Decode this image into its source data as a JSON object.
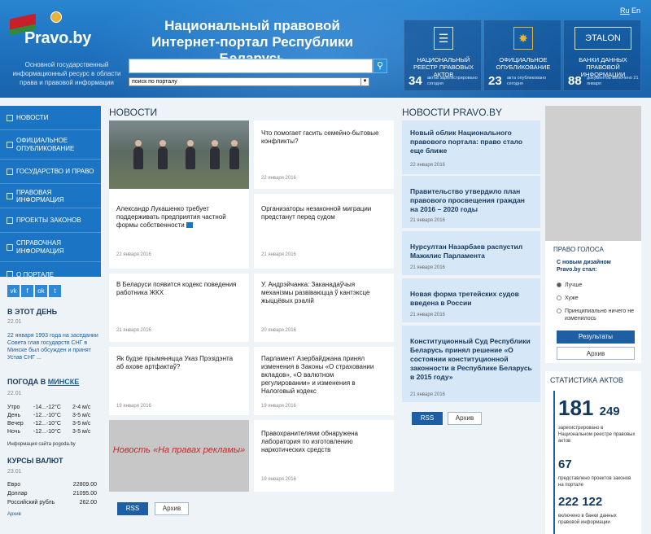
{
  "header": {
    "logo_text": "Pravo.by",
    "tagline": "Основной государственный информационный ресурс в области права и правовой информации",
    "title": "Национальный правовой Интернет-портал Республики Беларусь",
    "search_placeholder": "",
    "search_scope": "поиск по порталу",
    "lang_ru": "Ru",
    "lang_en": "En",
    "tiles": [
      {
        "name": "НАЦИОНАЛЬНЫЙ РЕЕСТР ПРАВОВЫХ АКТОВ",
        "count": "34",
        "sub": "актов зарегистрировано сегодня",
        "icon": "document-icon"
      },
      {
        "name": "ОФИЦИАЛЬНОЕ ОПУБЛИКОВАНИЕ",
        "count": "23",
        "sub": "акта опубликовано сегодня",
        "icon": "emblem-icon"
      },
      {
        "name": "БАНКИ ДАННЫХ ПРАВОВОЙ ИНФОРМАЦИИ",
        "count": "88",
        "sub": "документов включено 21 января",
        "icon": "etalon-icon"
      }
    ]
  },
  "sidebar": {
    "items": [
      {
        "label": "НОВОСТИ",
        "icon": "news-icon"
      },
      {
        "label": "ОФИЦИАЛЬНОЕ ОПУБЛИКОВАНИЕ",
        "icon": "publication-icon"
      },
      {
        "label": "ГОСУДАРСТВО И ПРАВО",
        "icon": "state-icon"
      },
      {
        "label": "ПРАВОВАЯ ИНФОРМАЦИЯ",
        "icon": "legal-icon"
      },
      {
        "label": "ПРОЕКТЫ ЗАКОНОВ",
        "icon": "draft-icon"
      },
      {
        "label": "СПРАВОЧНАЯ ИНФОРМАЦИЯ",
        "icon": "info-icon"
      },
      {
        "label": "О ПОРТАЛЕ",
        "icon": "about-icon"
      }
    ],
    "social": [
      "vk",
      "f",
      "ok",
      "t"
    ],
    "today_title": "В ЭТОТ ДЕНЬ",
    "today_date": "22.01",
    "today_text": "22 января 1993 года на заседании Совета глав государств СНГ в Минске был обсужден и принят Устав СНГ ...",
    "weather_title": "ПОГОДА В",
    "weather_city": "МИНСКЕ",
    "weather_date": "22.01",
    "weather": [
      {
        "time": "Утро",
        "temp": "-14...-12°C",
        "wind": "2-4 м/с"
      },
      {
        "time": "День",
        "temp": "-12...-10°C",
        "wind": "3-5 м/с"
      },
      {
        "time": "Вечер",
        "temp": "-12...-10°C",
        "wind": "3-5 м/с"
      },
      {
        "time": "Ночь",
        "temp": "-12...-10°C",
        "wind": "3-5 м/с"
      }
    ],
    "weather_source": "Информация сайта pogoda.by",
    "rates_title": "КУРСЫ ВАЛЮТ",
    "rates_date": "23.01",
    "rates": [
      {
        "name": "Евро",
        "value": "22809.00"
      },
      {
        "name": "Доллар",
        "value": "21095.00"
      },
      {
        "name": "Российский рубль",
        "value": "262.00"
      }
    ],
    "rates_archive": "Архив"
  },
  "news": {
    "title": "НОВОСТИ",
    "items": [
      {
        "text": "Александр Лукашенко требует поддерживать предприятия частной формы собственности",
        "date": "22 января 2016"
      },
      {
        "text": "Что помогает гасить семейно-бытовые конфликты?",
        "date": "22 января 2016"
      },
      {
        "text": "Организаторы незаконной миграции предстанут перед судом",
        "date": "21 января 2016"
      },
      {
        "text": "В Беларуси появится кодекс поведения работника ЖКХ",
        "date": "21 января 2016"
      },
      {
        "text": "У. Андрэйчанка: Заканадаўчыя механізмы развіваюцца ў кантэксце жыццёвых рэалій",
        "date": "20 января 2016"
      },
      {
        "text": "Як будзе прымяняцца Указ Прэзідэнта аб ахове артфактаў?",
        "date": "19 января 2016"
      },
      {
        "text": "Парламент Азербайджана принял изменения в Законы «О страховании вкладов», «О валютном регулировании» и изменения в Налоговый кодекс",
        "date": "19 января 2016"
      },
      {
        "text": "Правохранителями обнаружена лаборатория по изготовлению наркотических средств",
        "date": "19 января 2016"
      }
    ],
    "ad": "Новость «На правах рекламы»",
    "rss": "RSS",
    "archive": "Архив"
  },
  "portal_news": {
    "title": "НОВОСТИ PRAVO.BY",
    "items": [
      {
        "text": "Новый облик Национального правового портала: право стало еще ближе",
        "date": "22 января 2016"
      },
      {
        "text": "Правительство утвердило план правового просвещения граждан на 2016 – 2020 годы",
        "date": "21 января 2016"
      },
      {
        "text": "Нурсултан Назарбаев распустил Мажилис Парламента",
        "date": "21 января 2016"
      },
      {
        "text": "Новая форма третейских судов введена в России",
        "date": "21 января 2016"
      },
      {
        "text": "Конституционный Суд Республики Беларусь принял решение «О состоянии конституционной законности в Республике Беларусь в 2015 году»",
        "date": "21 января 2016"
      }
    ],
    "rss": "RSS",
    "archive": "Архив"
  },
  "poll": {
    "title": "ПРАВО ГОЛОСА",
    "question": "С новым дизайном Pravo.by стал:",
    "options": [
      "Лучше",
      "Хуже",
      "Принципиально ничего не изменилось"
    ],
    "results": "Результаты",
    "archive": "Архив"
  },
  "stats": {
    "title": "СТАТИСТИКА АКТОВ",
    "total_main": "181",
    "total_rest": "249",
    "total_desc": "зарегистрировано в Национальном реестре правовых актов",
    "drafts": "67",
    "drafts_desc": "представлено проектов законов на портале",
    "banks": "222 122",
    "banks_desc": "включено в банки данных правовой информации"
  },
  "colors": {
    "header": "#1d70bc",
    "sidebar": "#1b75c4",
    "card_highlight": "#d6e8f7",
    "accent": "#1e5fa3",
    "ad_text": "#c62828"
  }
}
